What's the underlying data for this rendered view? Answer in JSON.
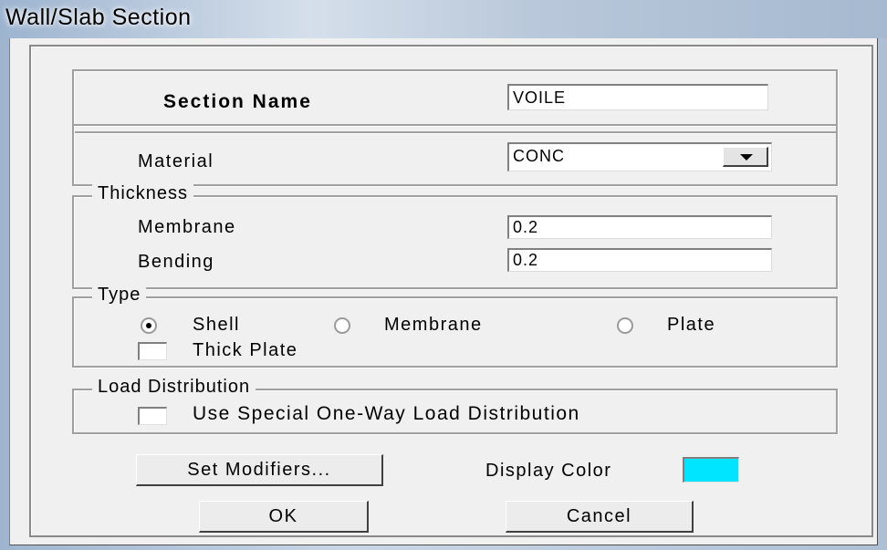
{
  "window": {
    "title": "Wall/Slab Section"
  },
  "section_name": {
    "label": "Section Name",
    "value": "VOILE"
  },
  "material": {
    "label": "Material",
    "selected": "CONC"
  },
  "thickness": {
    "legend": "Thickness",
    "membrane_label": "Membrane",
    "membrane_value": "0.2",
    "bending_label": "Bending",
    "bending_value": "0.2"
  },
  "type": {
    "legend": "Type",
    "options": [
      {
        "label": "Shell",
        "checked": true
      },
      {
        "label": "Membrane",
        "checked": false
      },
      {
        "label": "Plate",
        "checked": false
      }
    ],
    "thick_plate_label": "Thick Plate"
  },
  "load_distribution": {
    "legend": "Load Distribution",
    "checkbox_label": "Use Special One-Way Load Distribution"
  },
  "buttons": {
    "set_modifiers": "Set Modifiers...",
    "ok": "OK",
    "cancel": "Cancel"
  },
  "display_color": {
    "label": "Display Color",
    "color": "#00e5ff"
  }
}
